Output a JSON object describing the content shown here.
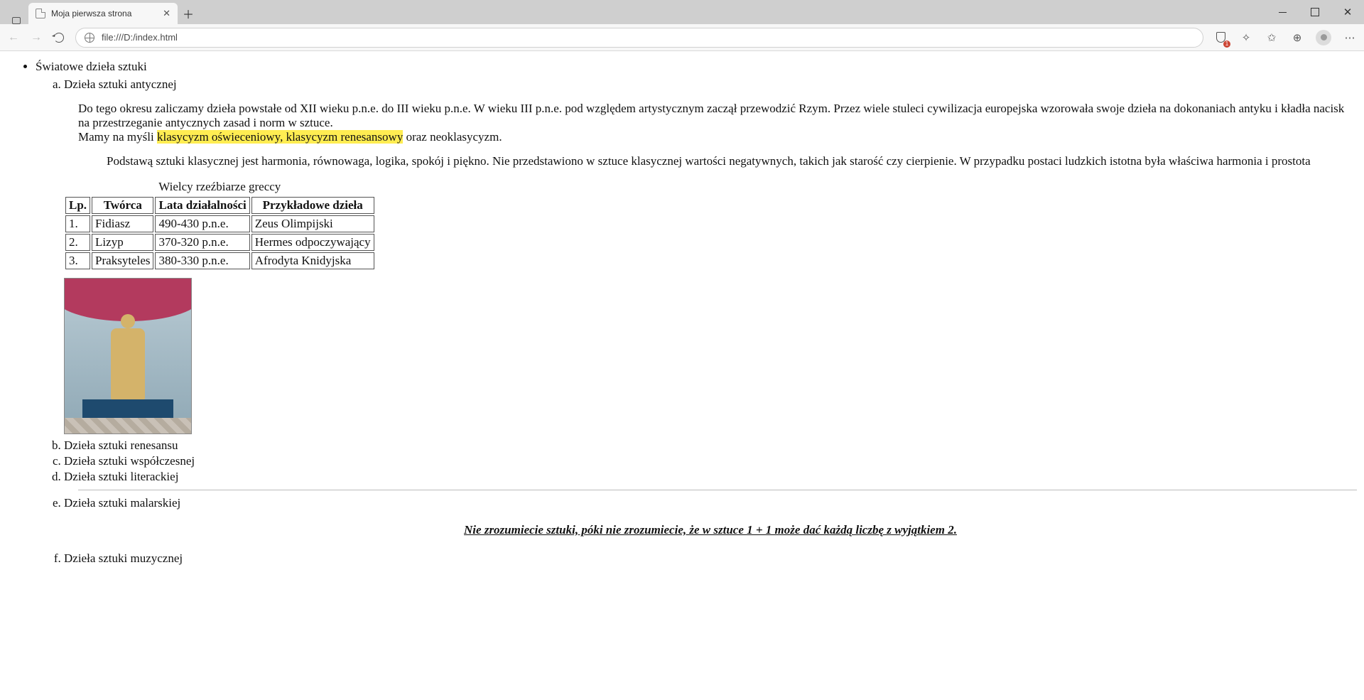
{
  "browser": {
    "tab_title": "Moja pierwsza strona",
    "url": "file:///D:/index.html",
    "shield_badge": "1"
  },
  "content": {
    "bullet_main": "Światowe dzieła sztuki",
    "items": {
      "a": "Dzieła sztuki antycznej",
      "b": "Dzieła sztuki renesansu",
      "c": "Dzieła sztuki współczesnej",
      "d": "Dzieła sztuki literackiej",
      "e": "Dzieła sztuki malarskiej",
      "f": "Dzieła sztuki muzycznej"
    },
    "p1_a": "Do tego okresu zaliczamy dzieła powstałe od XII wieku p.n.e. do III wieku p.n.e. W wieku III p.n.e. pod względem artystycznym zaczął przewodzić Rzym. Przez wiele stuleci cywilizacja europejska wzorowała swoje dzieła na dokonaniach antyku i kładła nacisk na przestrzeganie antycznych zasad i norm w sztuce.",
    "p1_b_prefix": "Mamy na myśli ",
    "p1_b_mark": "klasycyzm oświeceniowy, klasycyzm renesansowy",
    "p1_b_suffix": " oraz neoklasycyzm.",
    "p2": "Podstawą sztuki klasycznej jest harmonia, równowaga, logika, spokój i piękno. Nie przedstawiono w sztuce klasycznej wartości negatywnych, takich jak starość czy cierpienie. W przypadku postaci ludzkich istotna była właściwa harmonia i prostota",
    "table": {
      "caption": "Wielcy rzeźbiarze greccy",
      "headers": {
        "lp": "Lp.",
        "tworca": "Twórca",
        "lata": "Lata działalności",
        "dziela": "Przykładowe dzieła"
      },
      "rows": [
        {
          "lp": "1.",
          "tworca": "Fidiasz",
          "lata": "490-430 p.n.e.",
          "dziela": "Zeus Olimpijski"
        },
        {
          "lp": "2.",
          "tworca": "Lizyp",
          "lata": "370-320 p.n.e.",
          "dziela": "Hermes odpoczywający"
        },
        {
          "lp": "3.",
          "tworca": "Praksyteles",
          "lata": "380-330 p.n.e.",
          "dziela": "Afrodyta Knidyjska"
        }
      ]
    },
    "quote": "Nie zrozumiecie sztuki, póki nie zrozumiecie, że w sztuce 1 + 1 może dać każdą liczbę z wyjątkiem 2."
  }
}
